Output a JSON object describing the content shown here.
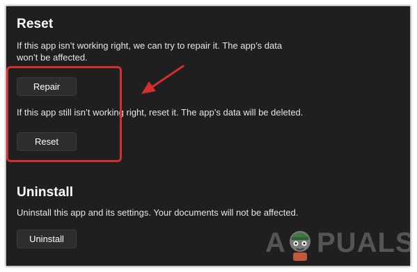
{
  "reset_section": {
    "title": "Reset",
    "description_line1": "If this app isn’t working right, we can try to repair it. The app’s data",
    "description_line2": "won’t be affected.",
    "repair_button": "Repair",
    "reset_description": "If this app still isn’t working right, reset it. The app’s data will be deleted.",
    "reset_button": "Reset"
  },
  "uninstall_section": {
    "title": "Uninstall",
    "description": "Uninstall this app and its settings. Your documents will not be affected.",
    "uninstall_button": "Uninstall"
  },
  "watermark": {
    "text_left": "A",
    "text_right": "PUALS"
  },
  "colors": {
    "panel_background": "#1f1f1f",
    "button_background": "#2d2d2d",
    "annotation_red": "#d32f2f"
  }
}
